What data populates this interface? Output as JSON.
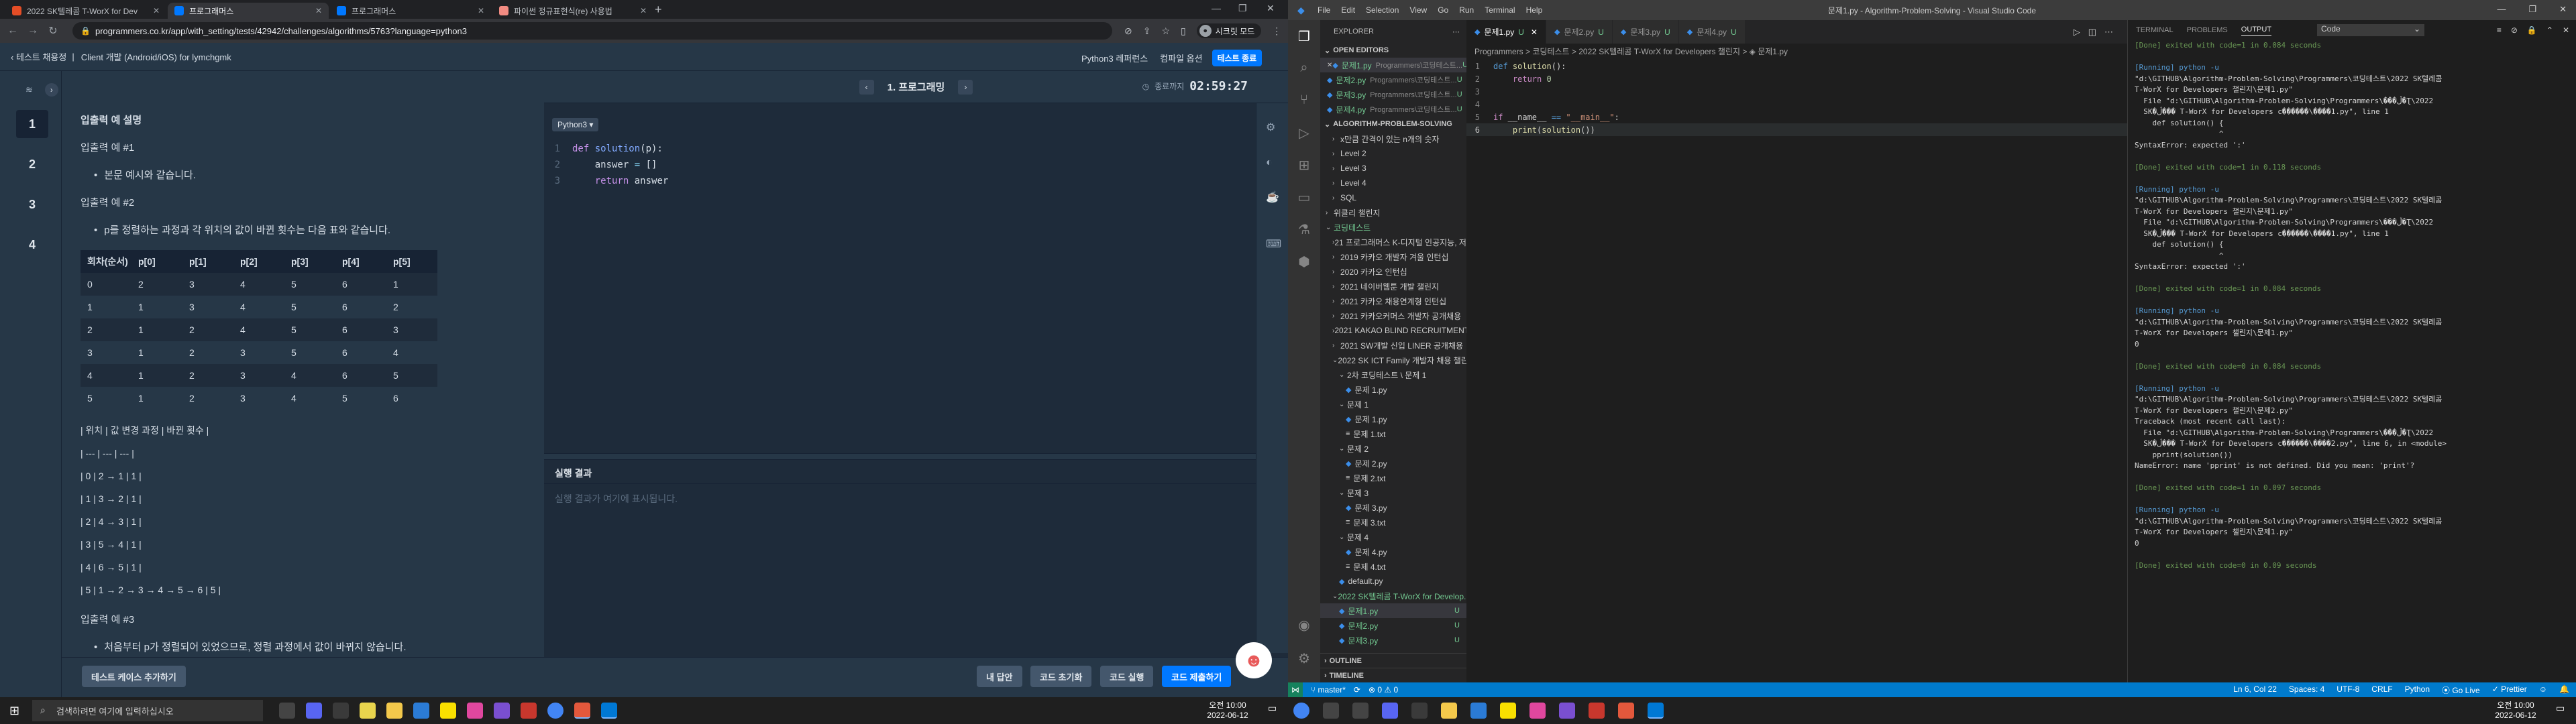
{
  "chrome": {
    "tabs": [
      {
        "label": "2022 SK텔레콤 T-WorX for Dev",
        "color": "#e44d26",
        "active": false
      },
      {
        "label": "프로그래머스",
        "color": "#0078ff",
        "active": true
      },
      {
        "label": "프로그래머스",
        "color": "#0078ff",
        "active": false
      },
      {
        "label": "파이썬 정규표현식(re) 사용법",
        "color": "#f28b82",
        "active": false
      }
    ],
    "url": "programmers.co.kr/app/with_setting/tests/42942/challenges/algorithms/5763?language=python3",
    "incognito_label": "시크릿 모드"
  },
  "programmers": {
    "back_label": "테스트 채용정",
    "crumb_sep": "|",
    "test_title": "Client 개발 (Android/iOS) for lymchgmk",
    "reference_label": "Python3 레퍼런스",
    "compiler_label": "컴파일 옵션",
    "end_label": "테스트 종료",
    "questions": [
      "1",
      "2",
      "3",
      "4"
    ],
    "problem_title": "1. 프로그래밍",
    "timer_label": "종료까지",
    "timer": "02:59:27",
    "language": "Python3 ▾",
    "result_title": "실행 결과",
    "result_placeholder": "실행 결과가 여기에 표시됩니다.",
    "buttons": {
      "add_case": "테스트 케이스 추가하기",
      "my_answer": "내 답안",
      "reset": "코드 초기화",
      "run": "코드 실행",
      "submit": "코드 제출하기"
    },
    "description": {
      "heading": "입출력 예 설명",
      "ex1_title": "입출력 예 #1",
      "ex1_item": "본문 예시와 같습니다.",
      "ex2_title": "입출력 예 #2",
      "ex2_item": "p를 정렬하는 과정과 각 위치의 값이 바뀐 횟수는 다음 표와 같습니다.",
      "table_headers": [
        "회차(순서)",
        "p[0]",
        "p[1]",
        "p[2]",
        "p[3]",
        "p[4]",
        "p[5]"
      ],
      "table_rows": [
        [
          "0",
          "2",
          "3",
          "4",
          "5",
          "6",
          "1"
        ],
        [
          "1",
          "1",
          "3",
          "4",
          "5",
          "6",
          "2"
        ],
        [
          "2",
          "1",
          "2",
          "4",
          "5",
          "6",
          "3"
        ],
        [
          "3",
          "1",
          "2",
          "3",
          "5",
          "6",
          "4"
        ],
        [
          "4",
          "1",
          "2",
          "3",
          "4",
          "6",
          "5"
        ],
        [
          "5",
          "1",
          "2",
          "3",
          "4",
          "5",
          "6"
        ]
      ],
      "md_lines": [
        "| 위치 | 값 변경 과정 | 바뀐 횟수 |",
        "| --- | --- | --- |",
        "| 0 | 2 → 1 | 1 |",
        "| 1 | 3 → 2 | 1 |",
        "| 2 | 4 → 3 | 1 |",
        "| 3 | 5 → 4 | 1 |",
        "| 4 | 6 → 5 | 1 |",
        "| 5 | 1 → 2 → 3 → 4 → 5 → 6 | 5 |"
      ],
      "ex3_title": "입출력 예 #3",
      "ex3_item": "처음부터 p가 정렬되어 있었으므로, 정렬 과정에서 값이 바뀌지 않습니다."
    },
    "code_lines": [
      "1",
      "2",
      "3"
    ]
  },
  "vscode": {
    "menu": [
      "File",
      "Edit",
      "Selection",
      "View",
      "Go",
      "Run",
      "Terminal",
      "Help"
    ],
    "window_title": "문제1.py - Algorithm-Problem-Solving - Visual Studio Code",
    "explorer_label": "EXPLORER",
    "open_editors_label": "OPEN EDITORS",
    "open_editors": [
      {
        "name": "문제1.py",
        "path": "Programmers\\코딩테스트...",
        "badge": "U",
        "sel": true
      },
      {
        "name": "문제2.py",
        "path": "Programmers\\코딩테스트...",
        "badge": "U",
        "sel": false
      },
      {
        "name": "문제3.py",
        "path": "Programmers\\코딩테스트...",
        "badge": "U",
        "sel": false
      },
      {
        "name": "문제4.py",
        "path": "Programmers\\코딩테스트...",
        "badge": "U",
        "sel": false
      }
    ],
    "workspace_label": "ALGORITHM-PROBLEM-SOLVING",
    "tree": [
      {
        "d": 1,
        "ch": "›",
        "t": "x만큼 간격이 있는 n개의 숫자"
      },
      {
        "d": 1,
        "ch": "›",
        "t": "Level 2"
      },
      {
        "d": 1,
        "ch": "›",
        "t": "Level 3"
      },
      {
        "d": 1,
        "ch": "›",
        "t": "Level 4"
      },
      {
        "d": 1,
        "ch": "›",
        "t": "SQL"
      },
      {
        "d": 0,
        "ch": "›",
        "t": "위클리 챌린지"
      },
      {
        "d": 0,
        "ch": "⌄",
        "t": "코딩테스트",
        "g": true
      },
      {
        "d": 1,
        "ch": "›",
        "t": "21 프로그래머스 K-디지털 인공지능, 저..."
      },
      {
        "d": 1,
        "ch": "›",
        "t": "2019 카카오 개발자 겨울 인턴십"
      },
      {
        "d": 1,
        "ch": "›",
        "t": "2020 카카오 인턴십"
      },
      {
        "d": 1,
        "ch": "›",
        "t": "2021 네이버웹툰 개발 챌린지"
      },
      {
        "d": 1,
        "ch": "›",
        "t": "2021 카카오 채용연계형 인턴십"
      },
      {
        "d": 1,
        "ch": "›",
        "t": "2021 카카오커머스 개발자 공개채용"
      },
      {
        "d": 1,
        "ch": "›",
        "t": "2021 KAKAO BLIND RECRUITMENT"
      },
      {
        "d": 1,
        "ch": "›",
        "t": "2021 SW개발 신입 LINER 공개채용"
      },
      {
        "d": 1,
        "ch": "⌄",
        "t": "2022 SK ICT Family 개발자 채용 챌린지"
      },
      {
        "d": 2,
        "ch": "⌄",
        "t": "2차 코딩테스트 \\ 문제 1"
      },
      {
        "d": 3,
        "py": true,
        "t": "문제 1.py"
      },
      {
        "d": 2,
        "ch": "⌄",
        "t": "문제 1"
      },
      {
        "d": 3,
        "py": true,
        "t": "문제 1.py"
      },
      {
        "d": 3,
        "tx": true,
        "t": "문제 1.txt"
      },
      {
        "d": 2,
        "ch": "⌄",
        "t": "문제 2"
      },
      {
        "d": 3,
        "py": true,
        "t": "문제 2.py"
      },
      {
        "d": 3,
        "tx": true,
        "t": "문제 2.txt"
      },
      {
        "d": 2,
        "ch": "⌄",
        "t": "문제 3"
      },
      {
        "d": 3,
        "py": true,
        "t": "문제 3.py"
      },
      {
        "d": 3,
        "tx": true,
        "t": "문제 3.txt"
      },
      {
        "d": 2,
        "ch": "⌄",
        "t": "문제 4"
      },
      {
        "d": 3,
        "py": true,
        "t": "문제 4.py"
      },
      {
        "d": 3,
        "tx": true,
        "t": "문제 4.txt"
      },
      {
        "d": 2,
        "py": true,
        "t": "default.py"
      },
      {
        "d": 1,
        "ch": "⌄",
        "t": "2022 SK텔레콤 T-WorX for Develop...",
        "g": true
      },
      {
        "d": 2,
        "py": true,
        "t": "문제1.py",
        "g": true,
        "u": "U",
        "sel": true
      },
      {
        "d": 2,
        "py": true,
        "t": "문제2.py",
        "g": true,
        "u": "U"
      },
      {
        "d": 2,
        "py": true,
        "t": "문제3.py",
        "g": true,
        "u": "U"
      }
    ],
    "outline_label": "OUTLINE",
    "timeline_label": "TIMELINE",
    "editor_tabs": [
      {
        "name": "문제1.py",
        "badge": "U",
        "active": true
      },
      {
        "name": "문제2.py",
        "badge": "U",
        "active": false
      },
      {
        "name": "문제3.py",
        "badge": "U",
        "active": false
      },
      {
        "name": "문제4.py",
        "badge": "U",
        "active": false
      }
    ],
    "breadcrumb": "Programmers > 코딩테스트 > 2022 SK텔레콤 T-WorX for Developers 챌린지 > ◈ 문제1.py",
    "panel_tabs": [
      "TERMINAL",
      "PROBLEMS",
      "OUTPUT"
    ],
    "panel_dropdown": "Code",
    "output_lines": [
      {
        "c": "g",
        "t": "[Done] exited with code=1 in 0.084 seconds"
      },
      {
        "c": "",
        "t": ""
      },
      {
        "c": "b",
        "t": "[Running] python -u"
      },
      {
        "c": "w",
        "t": "\"d:\\GITHUB\\Algorithm-Problem-Solving\\Programmers\\코딩테스트\\2022 SK텔레콤"
      },
      {
        "c": "w",
        "t": "T-WorX for Developers 챌린지\\문제1.py\""
      },
      {
        "c": "w",
        "t": "  File \"d:\\GITHUB\\Algorithm-Problem-Solving\\Programmers\\�ڵ��׽�Ʈ\\2022"
      },
      {
        "c": "w",
        "t": "  SK�ڷ��� T-WorX for Developers c������\\����1.py\", line 1"
      },
      {
        "c": "w",
        "t": "    def solution() {"
      },
      {
        "c": "w",
        "t": "                   ^"
      },
      {
        "c": "w",
        "t": "SyntaxError: expected ':'"
      },
      {
        "c": "",
        "t": ""
      },
      {
        "c": "g",
        "t": "[Done] exited with code=1 in 0.118 seconds"
      },
      {
        "c": "",
        "t": ""
      },
      {
        "c": "b",
        "t": "[Running] python -u"
      },
      {
        "c": "w",
        "t": "\"d:\\GITHUB\\Algorithm-Problem-Solving\\Programmers\\코딩테스트\\2022 SK텔레콤"
      },
      {
        "c": "w",
        "t": "T-WorX for Developers 챌린지\\문제1.py\""
      },
      {
        "c": "w",
        "t": "  File \"d:\\GITHUB\\Algorithm-Problem-Solving\\Programmers\\�ڵ��׽�Ʈ\\2022"
      },
      {
        "c": "w",
        "t": "  SK�ڷ��� T-WorX for Developers c������\\����1.py\", line 1"
      },
      {
        "c": "w",
        "t": "    def solution() {"
      },
      {
        "c": "w",
        "t": "                   ^"
      },
      {
        "c": "w",
        "t": "SyntaxError: expected ':'"
      },
      {
        "c": "",
        "t": ""
      },
      {
        "c": "g",
        "t": "[Done] exited with code=1 in 0.084 seconds"
      },
      {
        "c": "",
        "t": ""
      },
      {
        "c": "b",
        "t": "[Running] python -u"
      },
      {
        "c": "w",
        "t": "\"d:\\GITHUB\\Algorithm-Problem-Solving\\Programmers\\코딩테스트\\2022 SK텔레콤"
      },
      {
        "c": "w",
        "t": "T-WorX for Developers 챌린지\\문제1.py\""
      },
      {
        "c": "w",
        "t": "0"
      },
      {
        "c": "",
        "t": ""
      },
      {
        "c": "g",
        "t": "[Done] exited with code=0 in 0.084 seconds"
      },
      {
        "c": "",
        "t": ""
      },
      {
        "c": "b",
        "t": "[Running] python -u"
      },
      {
        "c": "w",
        "t": "\"d:\\GITHUB\\Algorithm-Problem-Solving\\Programmers\\코딩테스트\\2022 SK텔레콤"
      },
      {
        "c": "w",
        "t": "T-WorX for Developers 챌린지\\문제2.py\""
      },
      {
        "c": "w",
        "t": "Traceback (most recent call last):"
      },
      {
        "c": "w",
        "t": "  File \"d:\\GITHUB\\Algorithm-Problem-Solving\\Programmers\\�ڵ��׽�Ʈ\\2022"
      },
      {
        "c": "w",
        "t": "  SK�ڷ��� T-WorX for Developers c������\\����2.py\", line 6, in <module>"
      },
      {
        "c": "w",
        "t": "    pprint(solution())"
      },
      {
        "c": "w",
        "t": "NameError: name 'pprint' is not defined. Did you mean: 'print'?"
      },
      {
        "c": "",
        "t": ""
      },
      {
        "c": "g",
        "t": "[Done] exited with code=1 in 0.097 seconds"
      },
      {
        "c": "",
        "t": ""
      },
      {
        "c": "b",
        "t": "[Running] python -u"
      },
      {
        "c": "w",
        "t": "\"d:\\GITHUB\\Algorithm-Problem-Solving\\Programmers\\코딩테스트\\2022 SK텔레콤"
      },
      {
        "c": "w",
        "t": "T-WorX for Developers 챌린지\\문제1.py\""
      },
      {
        "c": "w",
        "t": "0"
      },
      {
        "c": "",
        "t": ""
      },
      {
        "c": "g",
        "t": "[Done] exited with code=0 in 0.09 seconds"
      }
    ],
    "status": {
      "branch": "master*",
      "sync": "⟳",
      "problems": "⊗ 0 ⚠ 0",
      "position": "Ln 6, Col 22",
      "spaces": "Spaces: 4",
      "encoding": "UTF-8",
      "eol": "CRLF",
      "language": "Python",
      "golive": "⦿ Go Live",
      "prettier": "✓ Prettier"
    }
  },
  "taskbar": {
    "search_placeholder": "검색하려면 여기에 입력하십시오",
    "time": "오전 10:00",
    "date": "2022-06-12"
  }
}
